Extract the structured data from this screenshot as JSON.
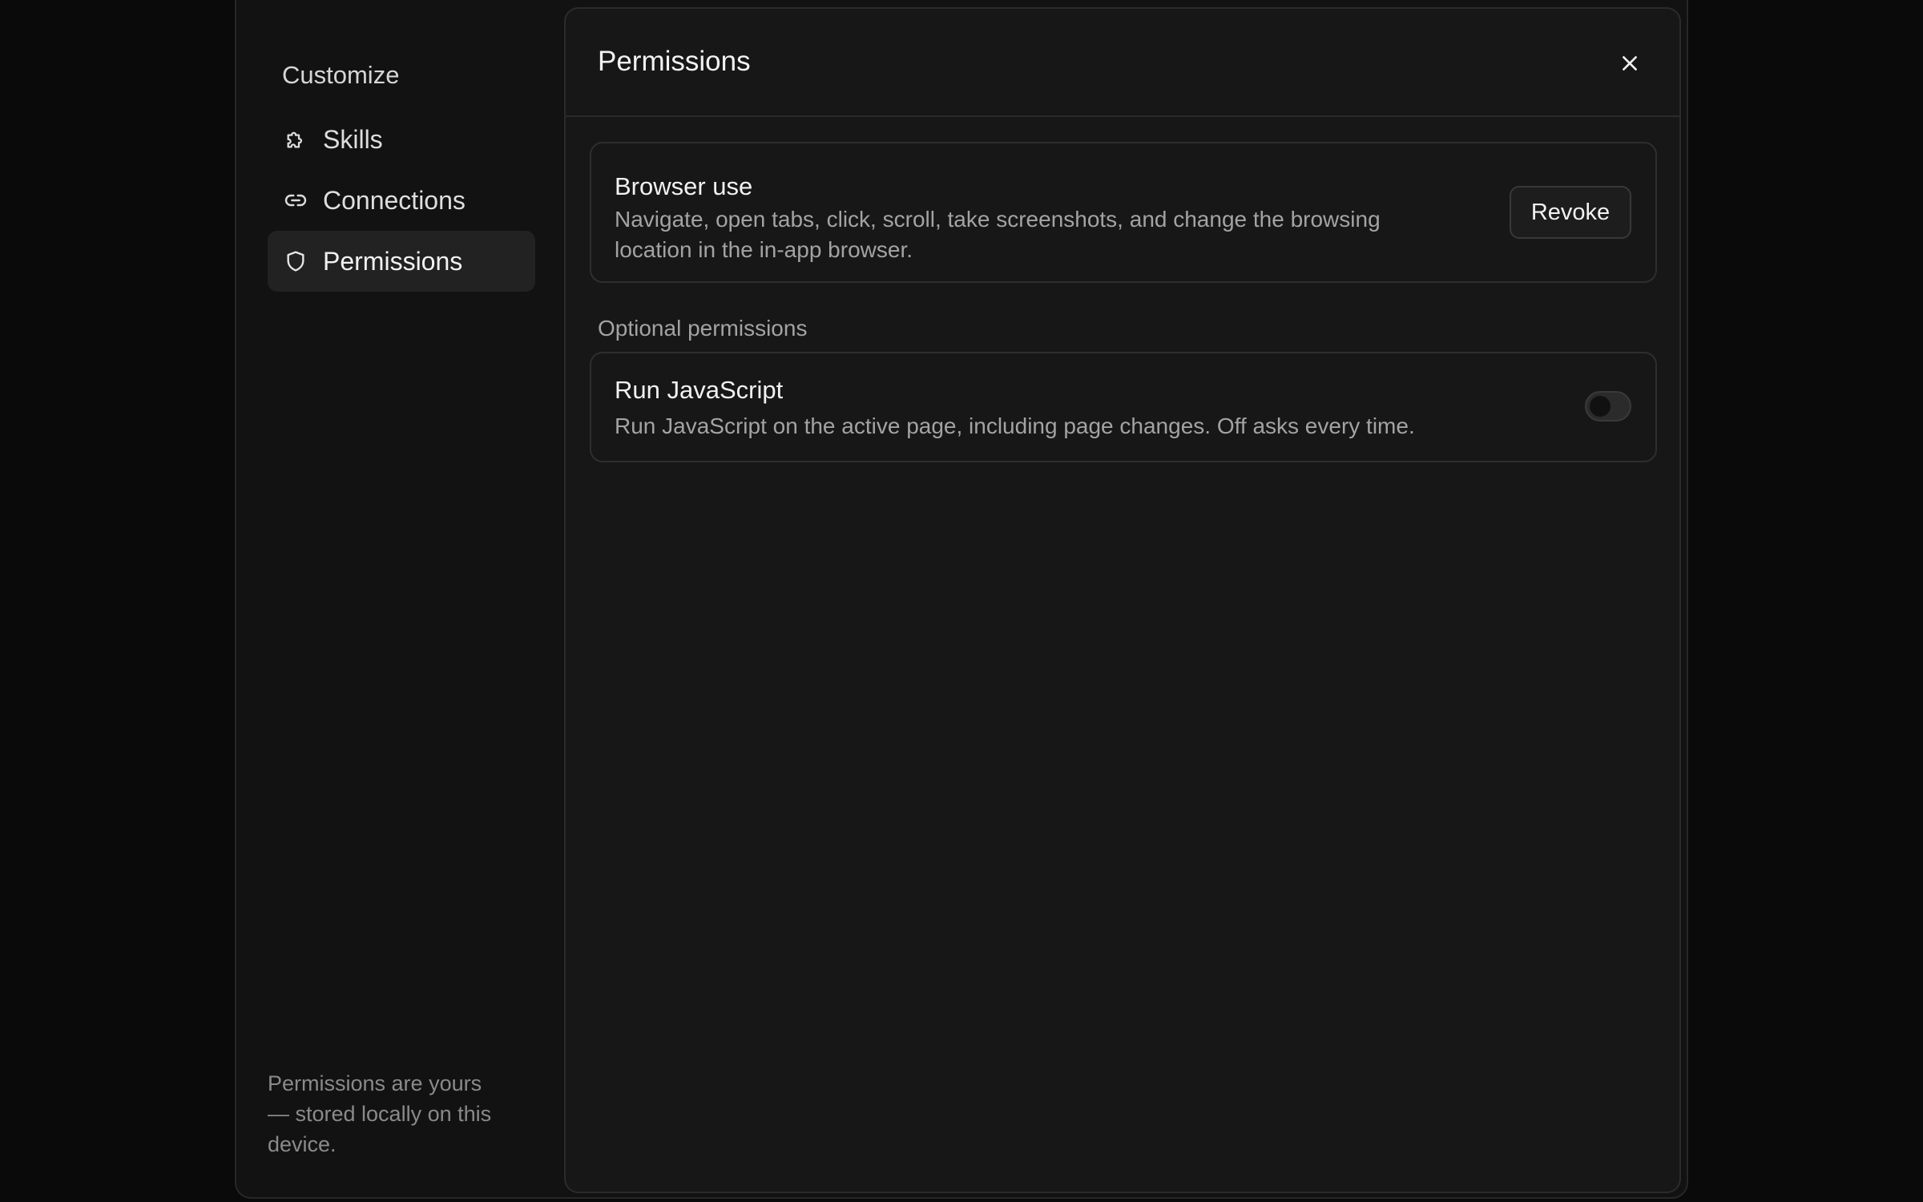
{
  "sidebar": {
    "title": "Customize",
    "items": [
      {
        "label": "Skills",
        "icon": "puzzle-icon",
        "active": false
      },
      {
        "label": "Connections",
        "icon": "link-icon",
        "active": false
      },
      {
        "label": "Permissions",
        "icon": "shield-icon",
        "active": true
      }
    ],
    "footer": "Permissions are yours — stored locally on this device."
  },
  "panel": {
    "title": "Permissions",
    "close_icon": "close-icon",
    "granted": {
      "title": "Browser use",
      "description": "Navigate, open tabs, click, scroll, take screenshots, and change the browsing location in the in-app browser.",
      "button_label": "Revoke"
    },
    "optional_label": "Optional permissions",
    "optional": {
      "title": "Run JavaScript",
      "description": "Run JavaScript on the active page, including page changes. Off asks every time.",
      "enabled": false
    }
  },
  "colors": {
    "background": "#0a0a0a",
    "sidebar": "#121212",
    "panel": "#171717",
    "active_item": "#222222",
    "border": "#2b2b2b",
    "text_primary": "#f2f2f2",
    "text_secondary": "#a3a3a3"
  }
}
